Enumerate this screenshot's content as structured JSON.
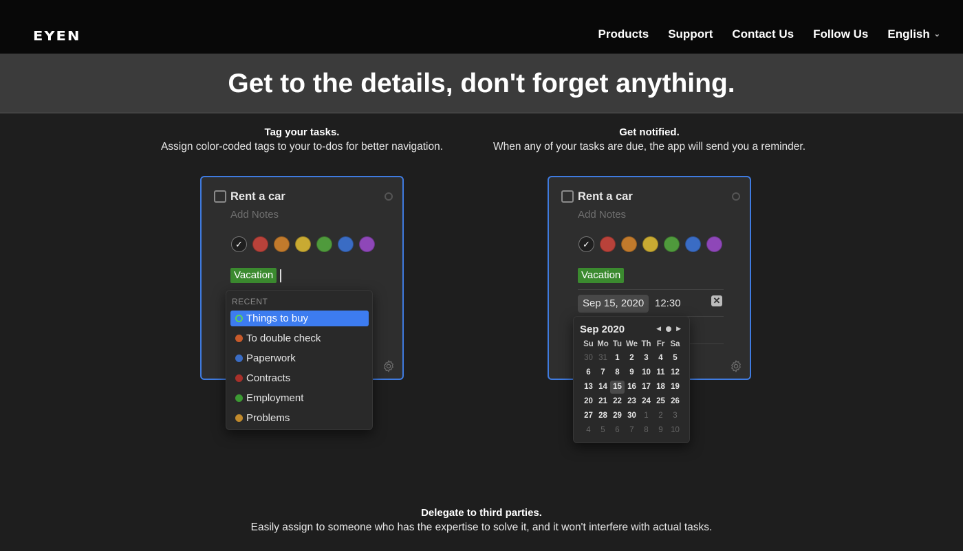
{
  "nav": {
    "logo": "EYEN",
    "links": [
      "Products",
      "Support",
      "Contact Us",
      "Follow Us"
    ],
    "language": "English"
  },
  "hero": {
    "title": "Get to the details, don't forget anything."
  },
  "features": {
    "tag": {
      "title": "Tag your tasks.",
      "description": "Assign color-coded tags to your to-dos for better navigation."
    },
    "notify": {
      "title": "Get notified.",
      "description": "When any of your tasks are due, the app will send you a reminder."
    },
    "delegate": {
      "title": "Delegate to third parties.",
      "description": "Easily assign to someone who has the expertise to solve it, and it won't interfere with actual tasks."
    }
  },
  "task": {
    "title": "Rent a car",
    "notes_placeholder": "Add Notes",
    "tag": "Vacation",
    "colors": [
      "#1f1f1f",
      "#b9423a",
      "#c17a2c",
      "#c9aa32",
      "#4f9a3c",
      "#3a6cc4",
      "#8e47b8"
    ],
    "selected_color_mark": "✓"
  },
  "dropdown": {
    "header": "RECENT",
    "items": [
      {
        "label": "Things to buy",
        "color": "#5ed35a",
        "active": true
      },
      {
        "label": "To double check",
        "color": "#c85a2a"
      },
      {
        "label": "Paperwork",
        "color": "#3a6cc4"
      },
      {
        "label": "Contracts",
        "color": "#a8302a"
      },
      {
        "label": "Employment",
        "color": "#3c9a33"
      },
      {
        "label": "Problems",
        "color": "#c18a2c"
      }
    ]
  },
  "reminder": {
    "date": "Sep 15, 2020",
    "time": "12:30",
    "clear_icon": "✕"
  },
  "calendar": {
    "title": "Sep 2020",
    "weekdays": [
      "Su",
      "Mo",
      "Tu",
      "We",
      "Th",
      "Fr",
      "Sa"
    ],
    "selected": "15",
    "weeks": [
      [
        "30",
        "31",
        "1",
        "2",
        "3",
        "4",
        "5"
      ],
      [
        "6",
        "7",
        "8",
        "9",
        "10",
        "11",
        "12"
      ],
      [
        "13",
        "14",
        "15",
        "16",
        "17",
        "18",
        "19"
      ],
      [
        "20",
        "21",
        "22",
        "23",
        "24",
        "25",
        "26"
      ],
      [
        "27",
        "28",
        "29",
        "30",
        "1",
        "2",
        "3"
      ],
      [
        "4",
        "5",
        "6",
        "7",
        "8",
        "9",
        "10"
      ]
    ]
  }
}
